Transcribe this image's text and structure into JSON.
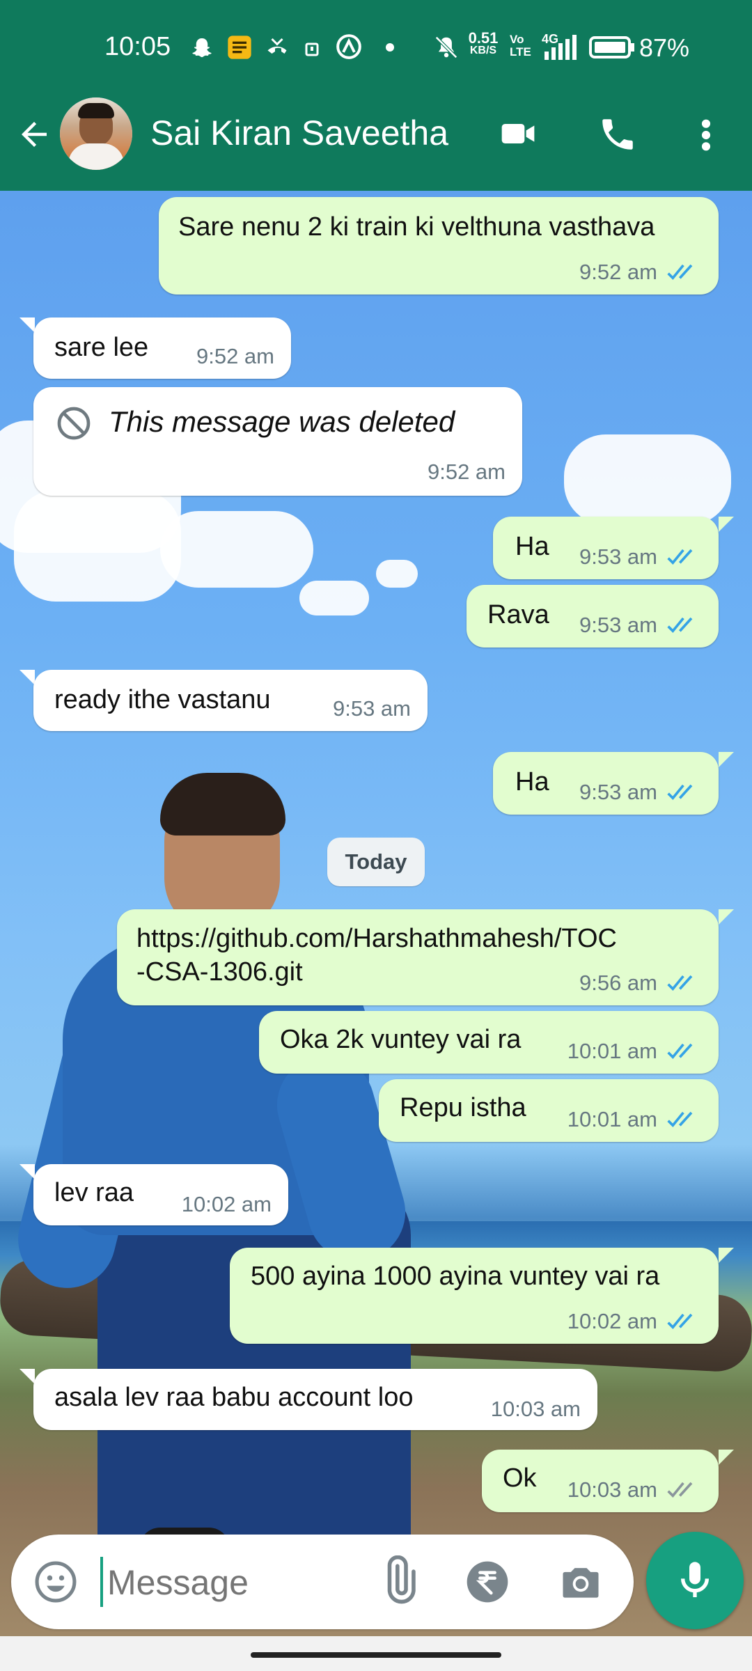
{
  "status_bar": {
    "time": "10:05",
    "net_speed_value": "0.51",
    "net_speed_unit": "KB/S",
    "volte": "Vo\nLTE",
    "signal_label": "4G",
    "battery": "87%"
  },
  "header": {
    "contact_name": "Sai Kiran Saveetha",
    "icons": [
      "back-arrow-icon",
      "video-call-icon",
      "phone-icon",
      "more-vert-icon"
    ]
  },
  "messages": [
    {
      "dir": "out",
      "text": "Sare nenu 2 ki train ki velthuna vasthava",
      "time": "9:52 am",
      "status": "read"
    },
    {
      "dir": "in",
      "text": "sare lee",
      "time": "9:52 am"
    },
    {
      "dir": "in",
      "text": "This message was deleted",
      "time": "9:52 am",
      "deleted": true
    },
    {
      "dir": "out",
      "text": "Ha",
      "time": "9:53 am",
      "status": "read"
    },
    {
      "dir": "out",
      "text": "Rava",
      "time": "9:53 am",
      "status": "read"
    },
    {
      "dir": "in",
      "text": "ready ithe vastanu",
      "time": "9:53 am"
    },
    {
      "dir": "out",
      "text": "Ha",
      "time": "9:53 am",
      "status": "read"
    },
    {
      "dir": "out",
      "text": "https://github.com/Harshathmahesh/TOC\n-CSA-1306.git",
      "time": "9:56 am",
      "status": "read",
      "link": true
    },
    {
      "dir": "out",
      "text": "Oka 2k vuntey vai ra",
      "time": "10:01 am",
      "status": "read"
    },
    {
      "dir": "out",
      "text": "Repu istha",
      "time": "10:01 am",
      "status": "read"
    },
    {
      "dir": "in",
      "text": "lev raa",
      "time": "10:02 am"
    },
    {
      "dir": "out",
      "text": "500 ayina 1000 ayina vuntey vai ra",
      "time": "10:02 am",
      "status": "read"
    },
    {
      "dir": "in",
      "text": "asala lev raa babu account loo",
      "time": "10:03 am"
    },
    {
      "dir": "out",
      "text": "Ok",
      "time": "10:03 am",
      "status": "delivered"
    }
  ],
  "date_separator": "Today",
  "composer": {
    "placeholder": "Message",
    "icons": [
      "emoji-icon",
      "attach-icon",
      "rupee-payment-icon",
      "camera-icon",
      "mic-icon"
    ]
  },
  "colors": {
    "header": "#0f7a5c",
    "outgoing_bubble": "#e2fdcf",
    "incoming_bubble": "#ffffff",
    "read_ticks": "#34a3e6",
    "delivered_ticks": "#8a959c",
    "mic_button": "#17a080"
  }
}
